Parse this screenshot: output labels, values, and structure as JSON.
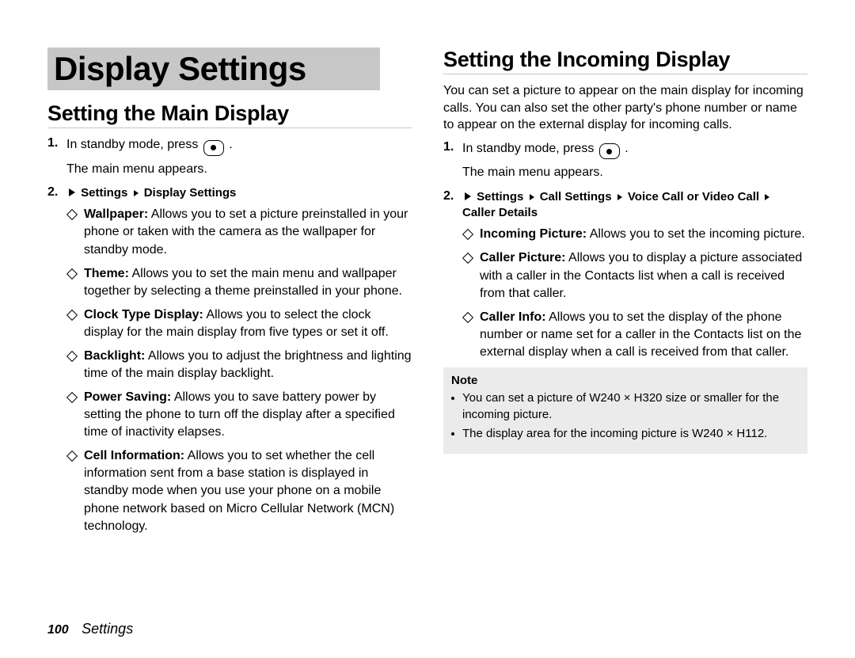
{
  "chapter_title": "Display Settings",
  "left": {
    "section_title": "Setting the Main Display",
    "step1_prefix": "In standby mode, press ",
    "step1_suffix": " .",
    "step1_sub": "The main menu appears.",
    "nav": {
      "a": "Settings",
      "b": "Display Settings"
    },
    "items": [
      {
        "label": "Wallpaper:",
        "text": " Allows you to set a picture preinstalled in your phone or taken with the camera as the wallpaper for standby mode."
      },
      {
        "label": "Theme:",
        "text": " Allows you to set the main menu and wallpaper together by selecting a theme preinstalled in your phone."
      },
      {
        "label": "Clock Type Display:",
        "text": " Allows you to select the clock display for the main display from five types or set it off."
      },
      {
        "label": "Backlight:",
        "text": " Allows you to adjust the brightness and lighting time of the main display backlight."
      },
      {
        "label": "Power Saving:",
        "text": " Allows you to save battery power by setting the phone to turn off the display after a specified time of inactivity elapses."
      },
      {
        "label": "Cell Information:",
        "text": " Allows you to set whether the cell information sent from a base station is displayed in standby mode when you use your phone on a mobile phone network based on Micro Cellular Network (MCN) technology."
      }
    ]
  },
  "right": {
    "section_title": "Setting the Incoming Display",
    "intro": "You can set a picture to appear on the main display for incoming calls. You can also set the other party's phone number or name to appear on the external display for incoming calls.",
    "step1_prefix": "In standby mode, press ",
    "step1_suffix": " .",
    "step1_sub": "The main menu appears.",
    "nav": {
      "a": "Settings",
      "b": "Call Settings",
      "c": "Voice Call",
      "or": " or ",
      "d": "Video Call",
      "e": "Caller Details"
    },
    "items": [
      {
        "label": "Incoming Picture:",
        "text": " Allows you to set the incoming picture."
      },
      {
        "label": "Caller Picture:",
        "text": " Allows you to display a picture associated with a caller in the Contacts list when a call is received from that caller."
      },
      {
        "label": "Caller Info:",
        "text": " Allows you to set the display of the phone number or name set for a caller in the Contacts list on the external display when a call is received from that caller."
      }
    ],
    "note_title": "Note",
    "notes": [
      "You can set a picture of W240 × H320 size or smaller for the incoming picture.",
      "The display area for the incoming picture is W240 × H112."
    ]
  },
  "footer": {
    "page": "100",
    "section": "Settings"
  }
}
